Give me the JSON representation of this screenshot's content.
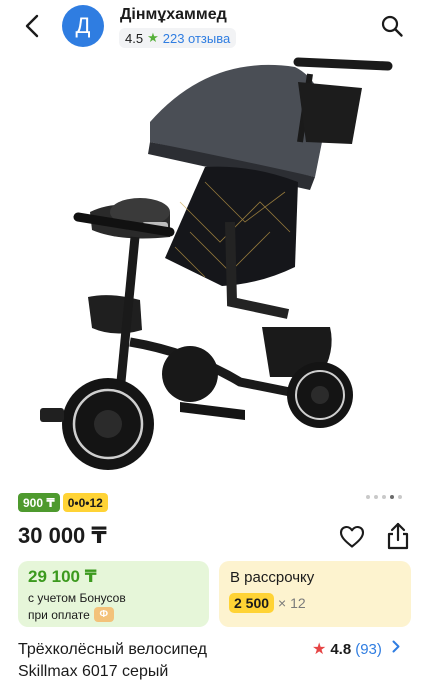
{
  "header": {
    "avatar_letter": "Д",
    "seller_name": "Дінмұхаммед",
    "seller_rating": "4.5",
    "reviews_text": "223 отзыва",
    "icons": {
      "back": "chevron-left-icon",
      "search": "search-icon",
      "star": "star-icon"
    }
  },
  "gallery": {
    "image": "tricycle-stroller-image",
    "slide_count": 5,
    "active_slide": 4
  },
  "badges": {
    "monthly": "900 ₸",
    "plan": "0•0•12"
  },
  "product": {
    "price": "30 000 ₸",
    "title_line1": "Трёхколёсный велосипед",
    "title_line2": "Skillmax 6017 серый",
    "rating": "4.8",
    "rating_count": "(93)"
  },
  "bonus_card": {
    "price": "29 100 ₸",
    "line1": "с учетом Бонусов",
    "line2": "при оплате",
    "coin": "Ф"
  },
  "installment_card": {
    "label": "В рассрочку",
    "amount": "2 500",
    "times": "× 12"
  },
  "colors": {
    "brand_blue": "#2f7de1",
    "bonus_green": "#3c9a1e",
    "bonus_bg": "#e6f6d9",
    "installment_bg": "#fdf3cf",
    "yellow": "#ffd335",
    "rating_star": "#e64545"
  }
}
